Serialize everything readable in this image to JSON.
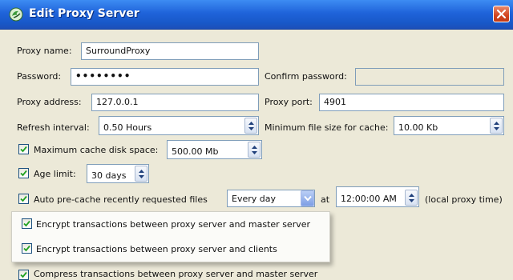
{
  "window": {
    "title": "Edit Proxy Server"
  },
  "proxy_name": {
    "label": "Proxy name:",
    "value": "SurroundProxy"
  },
  "password": {
    "label": "Password:",
    "value": "••••••••"
  },
  "confirm_password": {
    "label": "Confirm password:",
    "value": ""
  },
  "proxy_address": {
    "label": "Proxy address:",
    "value": "127.0.0.1"
  },
  "proxy_port": {
    "label": "Proxy port:",
    "value": "4901"
  },
  "refresh_interval": {
    "label": "Refresh interval:",
    "value": "0.50 Hours"
  },
  "min_file_size": {
    "label": "Minimum file size for cache:",
    "value": "10.00 Kb"
  },
  "max_cache": {
    "label": "Maximum cache disk space:",
    "value": "500.00 Mb",
    "checked": true
  },
  "age_limit": {
    "label": "Age limit:",
    "value": "30 days",
    "checked": true
  },
  "auto_precache": {
    "label": "Auto pre-cache recently requested files",
    "frequency": "Every day",
    "at_label": "at",
    "time": "12:00:00 AM",
    "suffix": "(local proxy time)",
    "checked": true
  },
  "encrypt_master": {
    "label": "Encrypt transactions between proxy server and master server",
    "checked": true
  },
  "encrypt_clients": {
    "label": "Encrypt transactions between proxy server and clients",
    "checked": true
  },
  "compress_master": {
    "label": "Compress transactions between proxy server and master server",
    "checked": true
  },
  "colors": {
    "titlebar": "#1f63da",
    "dialog_bg": "#ece9d8",
    "field_border": "#7f9db9",
    "check": "#21a121"
  }
}
